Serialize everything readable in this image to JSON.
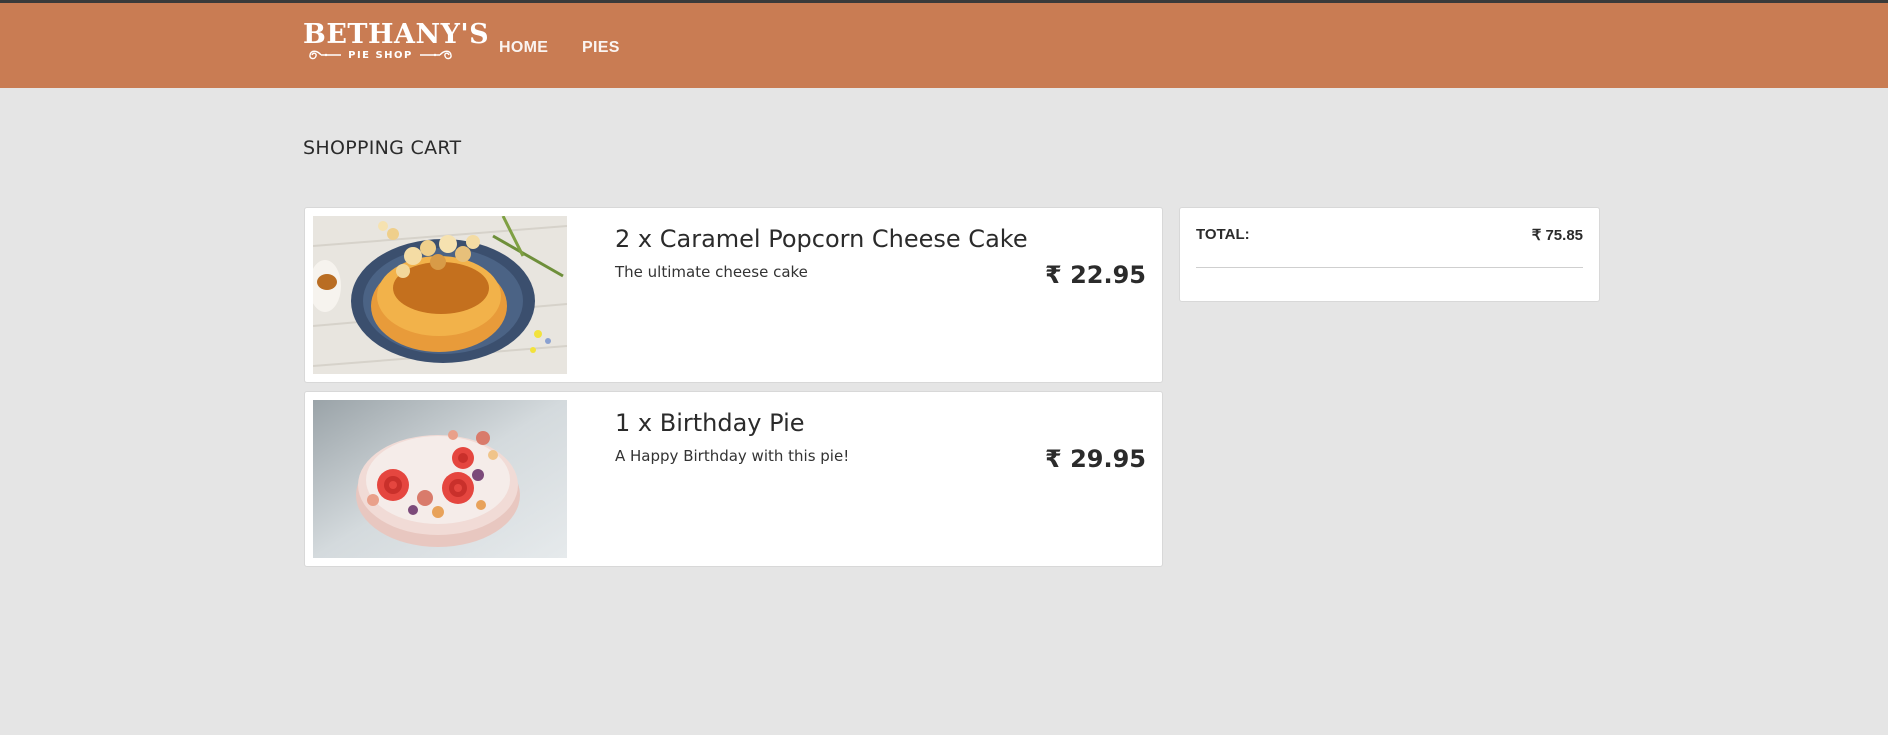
{
  "header": {
    "brand_main": "BETHANY'S",
    "brand_sub": "PIE SHOP",
    "nav": [
      {
        "label": "HOME"
      },
      {
        "label": "PIES"
      }
    ],
    "color": "#c97c53"
  },
  "page": {
    "title": "SHOPPING CART",
    "background": "#e5e5e5"
  },
  "cart": {
    "items": [
      {
        "name": "2 x Caramel Popcorn Cheese Cake",
        "description": "The ultimate cheese cake",
        "price": "₹ 22.95",
        "image": "caramel-popcorn-cheesecake-photo"
      },
      {
        "name": "1 x Birthday Pie",
        "description": "A Happy Birthday with this pie!",
        "price": "₹ 29.95",
        "image": "birthday-pie-photo"
      }
    ]
  },
  "summary": {
    "total_label": "TOTAL:",
    "total_value": "₹ 75.85"
  }
}
